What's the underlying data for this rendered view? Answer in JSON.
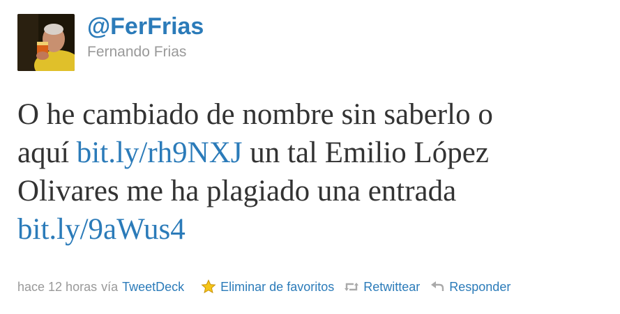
{
  "user": {
    "handle": "@FerFrias",
    "full_name": "Fernando Frias"
  },
  "tweet": {
    "lines": [
      {
        "segments": [
          {
            "text": "O he cambiado de nombre sin saberlo o",
            "link": false
          }
        ]
      },
      {
        "segments": [
          {
            "text": "aquí ",
            "link": false
          },
          {
            "text": "bit.ly/rh9NXJ",
            "link": true
          },
          {
            "text": " un tal Emilio López",
            "link": false
          }
        ]
      },
      {
        "segments": [
          {
            "text": "Olivares me ha plagiado una entrada",
            "link": false
          }
        ]
      },
      {
        "segments": [
          {
            "text": "bit.ly/9aWus4",
            "link": true
          }
        ]
      }
    ]
  },
  "meta": {
    "timestamp": "hace 12 horas",
    "via_label": "vía",
    "source": "TweetDeck"
  },
  "actions": {
    "favorite_label": "Eliminar de favoritos",
    "retweet_label": "Retwittear",
    "reply_label": "Responder"
  },
  "colors": {
    "link": "#2b7bb9",
    "text": "#333333",
    "muted": "#999999",
    "star": "#f5c518"
  },
  "icons": {
    "favorite": "star-icon",
    "retweet": "retweet-icon",
    "reply": "reply-icon"
  }
}
